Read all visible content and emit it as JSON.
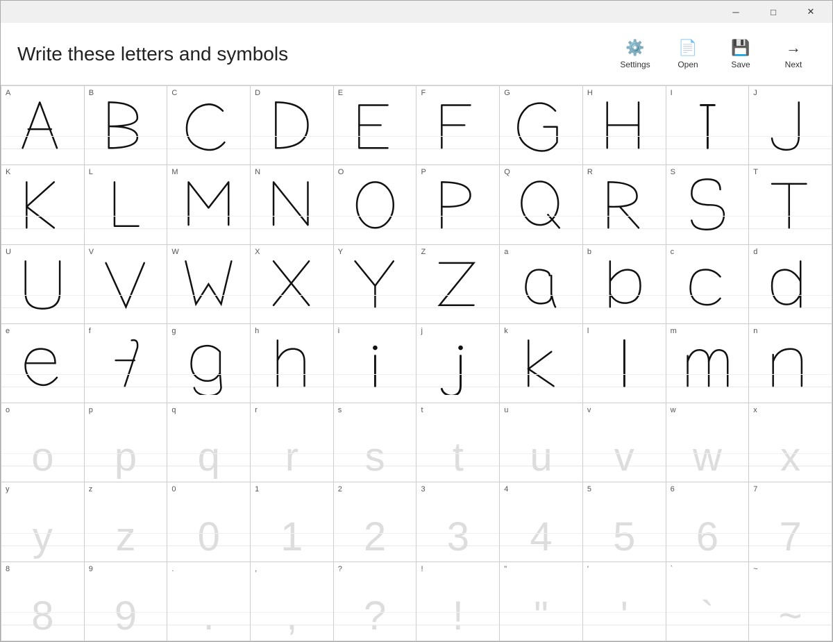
{
  "titlebar": {
    "minimize_label": "─",
    "maximize_label": "□",
    "close_label": "✕"
  },
  "header": {
    "title": "Write these letters and symbols",
    "toolbar": {
      "settings_label": "Settings",
      "open_label": "Open",
      "save_label": "Save",
      "next_label": "Next"
    }
  },
  "cells": [
    {
      "label": "A",
      "char": "A",
      "drawn": true
    },
    {
      "label": "B",
      "char": "B",
      "drawn": true
    },
    {
      "label": "C",
      "char": "C",
      "drawn": true
    },
    {
      "label": "D",
      "char": "D",
      "drawn": true
    },
    {
      "label": "E",
      "char": "E",
      "drawn": true
    },
    {
      "label": "F",
      "char": "F",
      "drawn": true
    },
    {
      "label": "G",
      "char": "G",
      "drawn": true
    },
    {
      "label": "H",
      "char": "H",
      "drawn": true
    },
    {
      "label": "I",
      "char": "I",
      "drawn": true
    },
    {
      "label": "J",
      "char": "J",
      "drawn": true
    },
    {
      "label": "K",
      "char": "K",
      "drawn": true
    },
    {
      "label": "L",
      "char": "L",
      "drawn": true
    },
    {
      "label": "M",
      "char": "M",
      "drawn": true
    },
    {
      "label": "N",
      "char": "N",
      "drawn": true
    },
    {
      "label": "O",
      "char": "O",
      "drawn": true
    },
    {
      "label": "P",
      "char": "P",
      "drawn": true
    },
    {
      "label": "Q",
      "char": "Q",
      "drawn": true
    },
    {
      "label": "R",
      "char": "R",
      "drawn": true
    },
    {
      "label": "S",
      "char": "S",
      "drawn": true
    },
    {
      "label": "T",
      "char": "T",
      "drawn": true
    },
    {
      "label": "U",
      "char": "U",
      "drawn": true
    },
    {
      "label": "V",
      "char": "V",
      "drawn": true
    },
    {
      "label": "W",
      "char": "W",
      "drawn": true
    },
    {
      "label": "X",
      "char": "X",
      "drawn": true
    },
    {
      "label": "Y",
      "char": "Y",
      "drawn": true
    },
    {
      "label": "Z",
      "char": "Z",
      "drawn": true
    },
    {
      "label": "a",
      "char": "a",
      "drawn": true
    },
    {
      "label": "b",
      "char": "b",
      "drawn": true
    },
    {
      "label": "c",
      "char": "c",
      "drawn": true
    },
    {
      "label": "d",
      "char": "d",
      "drawn": true
    },
    {
      "label": "e",
      "char": "e",
      "drawn": true
    },
    {
      "label": "f",
      "char": "f",
      "drawn": true
    },
    {
      "label": "g",
      "char": "g",
      "drawn": true
    },
    {
      "label": "h",
      "char": "h",
      "drawn": true
    },
    {
      "label": "i",
      "char": "i",
      "drawn": true
    },
    {
      "label": "j",
      "char": "j",
      "drawn": true
    },
    {
      "label": "k",
      "char": "k",
      "drawn": true
    },
    {
      "label": "l",
      "char": "l",
      "drawn": true
    },
    {
      "label": "m",
      "char": "m",
      "drawn": true
    },
    {
      "label": "n",
      "char": "n",
      "drawn": true
    },
    {
      "label": "o",
      "char": "o",
      "drawn": false
    },
    {
      "label": "p",
      "char": "p",
      "drawn": false
    },
    {
      "label": "q",
      "char": "q",
      "drawn": false
    },
    {
      "label": "r",
      "char": "r",
      "drawn": false
    },
    {
      "label": "s",
      "char": "s",
      "drawn": false
    },
    {
      "label": "t",
      "char": "t",
      "drawn": false
    },
    {
      "label": "u",
      "char": "u",
      "drawn": false
    },
    {
      "label": "v",
      "char": "v",
      "drawn": false
    },
    {
      "label": "w",
      "char": "w",
      "drawn": false
    },
    {
      "label": "x",
      "char": "x",
      "drawn": false
    },
    {
      "label": "y",
      "char": "y",
      "drawn": false
    },
    {
      "label": "z",
      "char": "z",
      "drawn": false
    },
    {
      "label": "0",
      "char": "0",
      "drawn": false
    },
    {
      "label": "1",
      "char": "1",
      "drawn": false
    },
    {
      "label": "2",
      "char": "2",
      "drawn": false
    },
    {
      "label": "3",
      "char": "3",
      "drawn": false
    },
    {
      "label": "4",
      "char": "4",
      "drawn": false
    },
    {
      "label": "5",
      "char": "5",
      "drawn": false
    },
    {
      "label": "6",
      "char": "6",
      "drawn": false
    },
    {
      "label": "7",
      "char": "7",
      "drawn": false
    },
    {
      "label": "8",
      "char": "8",
      "drawn": false
    },
    {
      "label": "9",
      "char": "9",
      "drawn": false
    },
    {
      "label": ".",
      "char": ".",
      "drawn": false
    },
    {
      "label": ",",
      "char": ",",
      "drawn": false
    },
    {
      "label": "?",
      "char": "?",
      "drawn": false
    },
    {
      "label": "!",
      "char": "!",
      "drawn": false
    },
    {
      "label": "\"",
      "char": "\"",
      "drawn": false
    },
    {
      "label": "'",
      "char": "'",
      "drawn": false
    },
    {
      "label": "`",
      "char": "`",
      "drawn": false
    },
    {
      "label": "~",
      "char": "~",
      "drawn": false
    }
  ]
}
